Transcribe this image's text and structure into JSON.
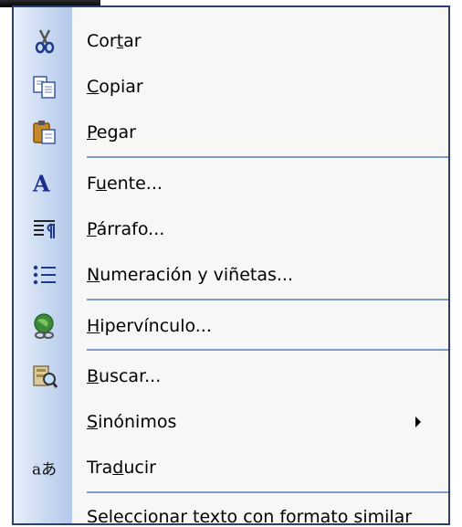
{
  "menu": {
    "items": [
      {
        "pre": "Cor",
        "key": "t",
        "post": "ar",
        "icon": "scissors-icon"
      },
      {
        "pre": "",
        "key": "C",
        "post": "opiar",
        "icon": "copy-icon"
      },
      {
        "pre": "",
        "key": "P",
        "post": "egar",
        "icon": "paste-icon"
      },
      {
        "pre": "F",
        "key": "u",
        "post": "ente...",
        "icon": "font-icon"
      },
      {
        "pre": "",
        "key": "P",
        "post": "árrafo...",
        "icon": "paragraph-icon"
      },
      {
        "pre": "",
        "key": "N",
        "post": "umeración y viñetas...",
        "icon": "bullets-icon"
      },
      {
        "pre": "",
        "key": "H",
        "post": "ipervínculo...",
        "icon": "hyperlink-icon"
      },
      {
        "pre": "",
        "key": "B",
        "post": "uscar...",
        "icon": "search-icon"
      },
      {
        "pre": "",
        "key": "S",
        "post": "inónimos",
        "icon": ""
      },
      {
        "pre": "Tra",
        "key": "d",
        "post": "ucir",
        "icon": "translate-icon"
      },
      {
        "pre": "",
        "key": "S",
        "post": "eleccionar texto con formato similar",
        "icon": ""
      }
    ],
    "font_icon_glyph": "A",
    "translate_icon_glyph": "aあ"
  }
}
